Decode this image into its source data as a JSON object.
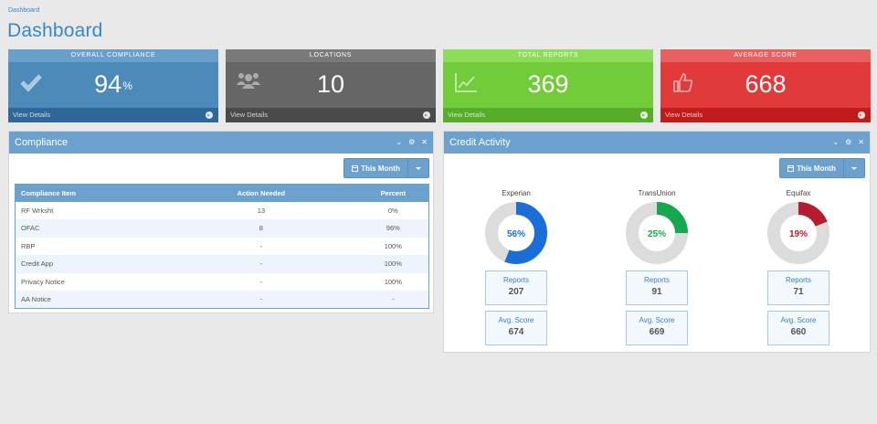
{
  "breadcrumb": "Dashboard",
  "page_title": "Dashboard",
  "stats": [
    {
      "title": "OVERALL COMPLIANCE",
      "value": "94",
      "unit": "%",
      "link": "View Details",
      "icon": "check-icon",
      "head_color": "#6a9fcc",
      "body_color": "#4b8ab9",
      "foot_color": "#2f6898"
    },
    {
      "title": "LOCATIONS",
      "value": "10",
      "unit": "",
      "link": "View Details",
      "icon": "users-icon",
      "head_color": "#7a7a7a",
      "body_color": "#666666",
      "foot_color": "#4a4a4a"
    },
    {
      "title": "TOTAL REPORTS",
      "value": "369",
      "unit": "",
      "link": "View Details",
      "icon": "line-chart-icon",
      "head_color": "#8ddc5a",
      "body_color": "#72cc3a",
      "foot_color": "#57ad29"
    },
    {
      "title": "AVERAGE SCORE",
      "value": "668",
      "unit": "",
      "link": "View Details",
      "icon": "thumbs-up-icon",
      "head_color": "#e86060",
      "body_color": "#e03a3a",
      "foot_color": "#c01c1c"
    }
  ],
  "compliance": {
    "title": "Compliance",
    "filter": "This Month",
    "columns": [
      "Compliance Item",
      "Action Needed",
      "Percent"
    ],
    "rows": [
      [
        "RF Wrksht",
        "13",
        "0%"
      ],
      [
        "OFAC",
        "8",
        "96%"
      ],
      [
        "RBP",
        "-",
        "100%"
      ],
      [
        "Credit App",
        "-",
        "100%"
      ],
      [
        "Privacy Notice",
        "-",
        "100%"
      ],
      [
        "AA Notice",
        "-",
        "-"
      ]
    ]
  },
  "credit": {
    "title": "Credit Activity",
    "filter": "This Month",
    "reports_label": "Reports",
    "score_label": "Avg. Score",
    "bureaus": [
      {
        "name": "Experian",
        "percent": 56,
        "percent_label": "56%",
        "color": "#1a6ed8",
        "reports": "207",
        "avg_score": "674"
      },
      {
        "name": "TransUnion",
        "percent": 25,
        "percent_label": "25%",
        "color": "#16a84e",
        "reports": "91",
        "avg_score": "669"
      },
      {
        "name": "Equifax",
        "percent": 19,
        "percent_label": "19%",
        "color": "#b51c30",
        "reports": "71",
        "avg_score": "660"
      }
    ]
  }
}
